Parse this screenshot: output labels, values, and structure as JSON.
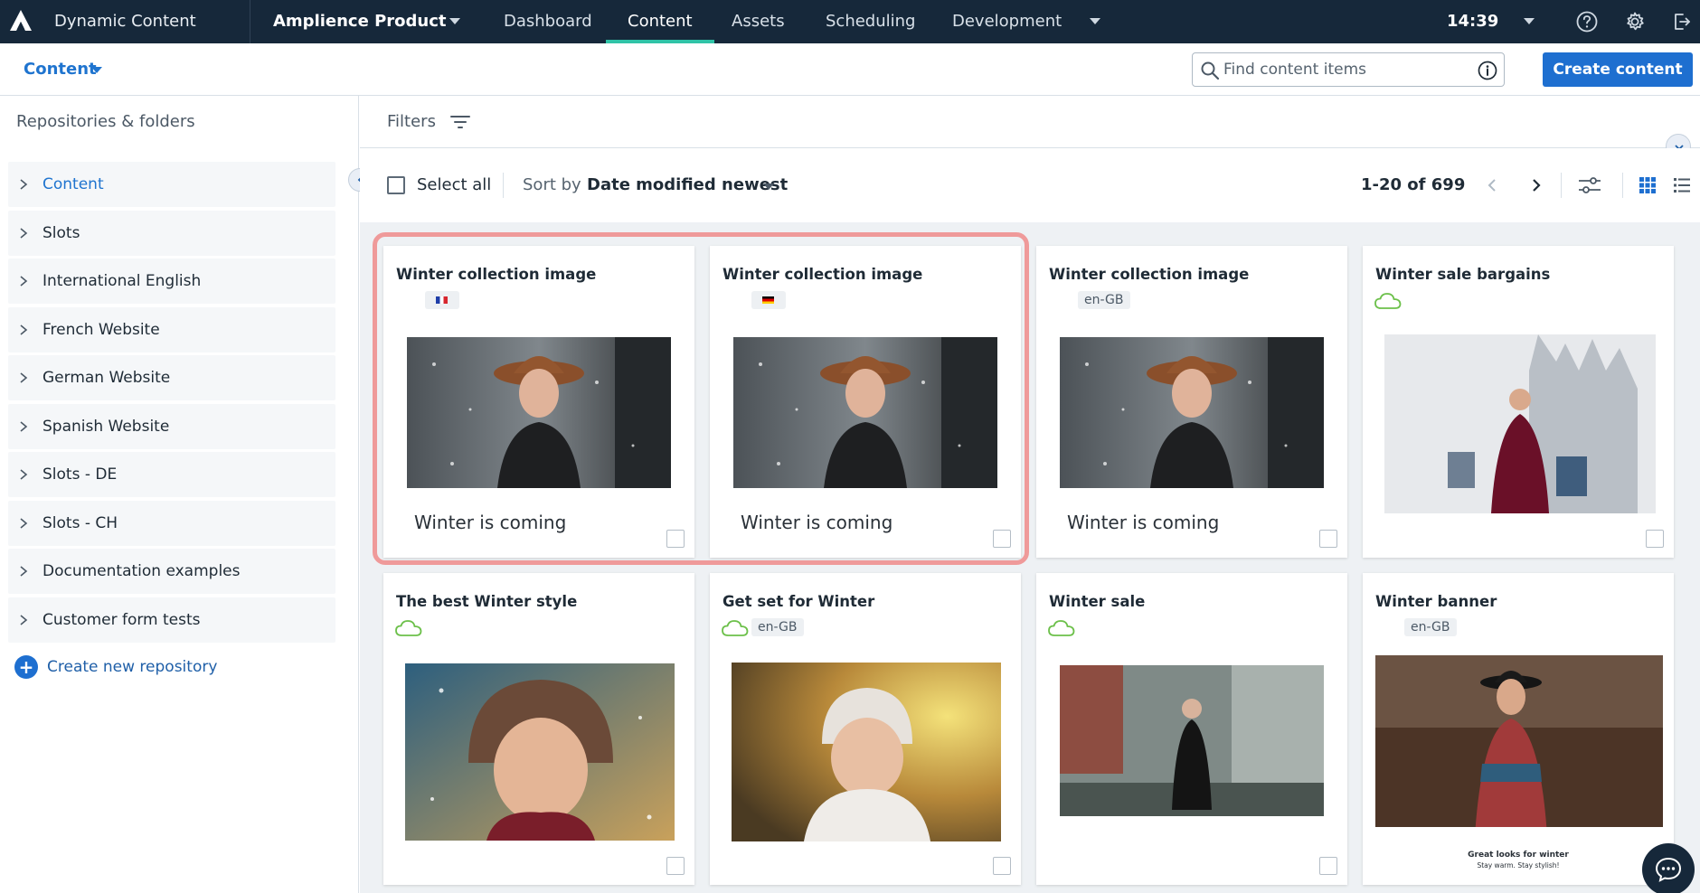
{
  "topbar": {
    "app_name": "Dynamic Content",
    "product": "Amplience Product",
    "tabs": [
      {
        "label": "Dashboard"
      },
      {
        "label": "Content",
        "active": true
      },
      {
        "label": "Assets"
      },
      {
        "label": "Scheduling"
      },
      {
        "label": "Development"
      }
    ],
    "time": "14:39",
    "icons": [
      "help-icon",
      "settings-gear-icon",
      "logout-icon"
    ]
  },
  "subbar": {
    "context": "Content",
    "search_placeholder": "Find content items",
    "create_label": "Create content"
  },
  "sidebar": {
    "heading": "Repositories & folders",
    "items": [
      {
        "label": "Content",
        "active": true
      },
      {
        "label": "Slots"
      },
      {
        "label": "International English"
      },
      {
        "label": "French Website"
      },
      {
        "label": "German Website"
      },
      {
        "label": "Spanish Website"
      },
      {
        "label": "Slots - DE"
      },
      {
        "label": "Slots - CH"
      },
      {
        "label": "Documentation examples"
      },
      {
        "label": "Customer form tests"
      }
    ],
    "create_label": "Create new repository"
  },
  "filters": {
    "label": "Filters"
  },
  "toolbar": {
    "select_all": "Select all",
    "sort_label": "Sort by",
    "sort_value": "Date modified newest",
    "pagination": "1-20 of 699"
  },
  "colors": {
    "nav_bg": "#16283a",
    "accent": "#1e6fd0",
    "active_tab_underline": "#30c3a7",
    "highlight": "#ef9a9a",
    "cloud_status": "#6cc04a"
  },
  "cards": [
    {
      "title": "Winter collection image",
      "locale_type": "flag",
      "locale": "fr-FR",
      "caption": "Winter is coming"
    },
    {
      "title": "Winter collection image",
      "locale_type": "flag",
      "locale": "de-DE",
      "caption": "Winter is coming"
    },
    {
      "title": "Winter collection image",
      "locale_type": "badge",
      "locale": "en-GB",
      "caption": "Winter is coming"
    },
    {
      "title": "Winter sale bargains",
      "locale_type": "cloud"
    },
    {
      "title": "The best Winter style",
      "locale_type": "cloud"
    },
    {
      "title": "Get set for Winter",
      "locale_type": "cloud+badge",
      "locale": "en-GB"
    },
    {
      "title": "Winter sale",
      "locale_type": "cloud"
    },
    {
      "title": "Winter banner",
      "locale_type": "badge",
      "locale": "en-GB",
      "caption_small": [
        "Great looks for winter",
        "Stay warm. Stay stylish!"
      ]
    }
  ]
}
